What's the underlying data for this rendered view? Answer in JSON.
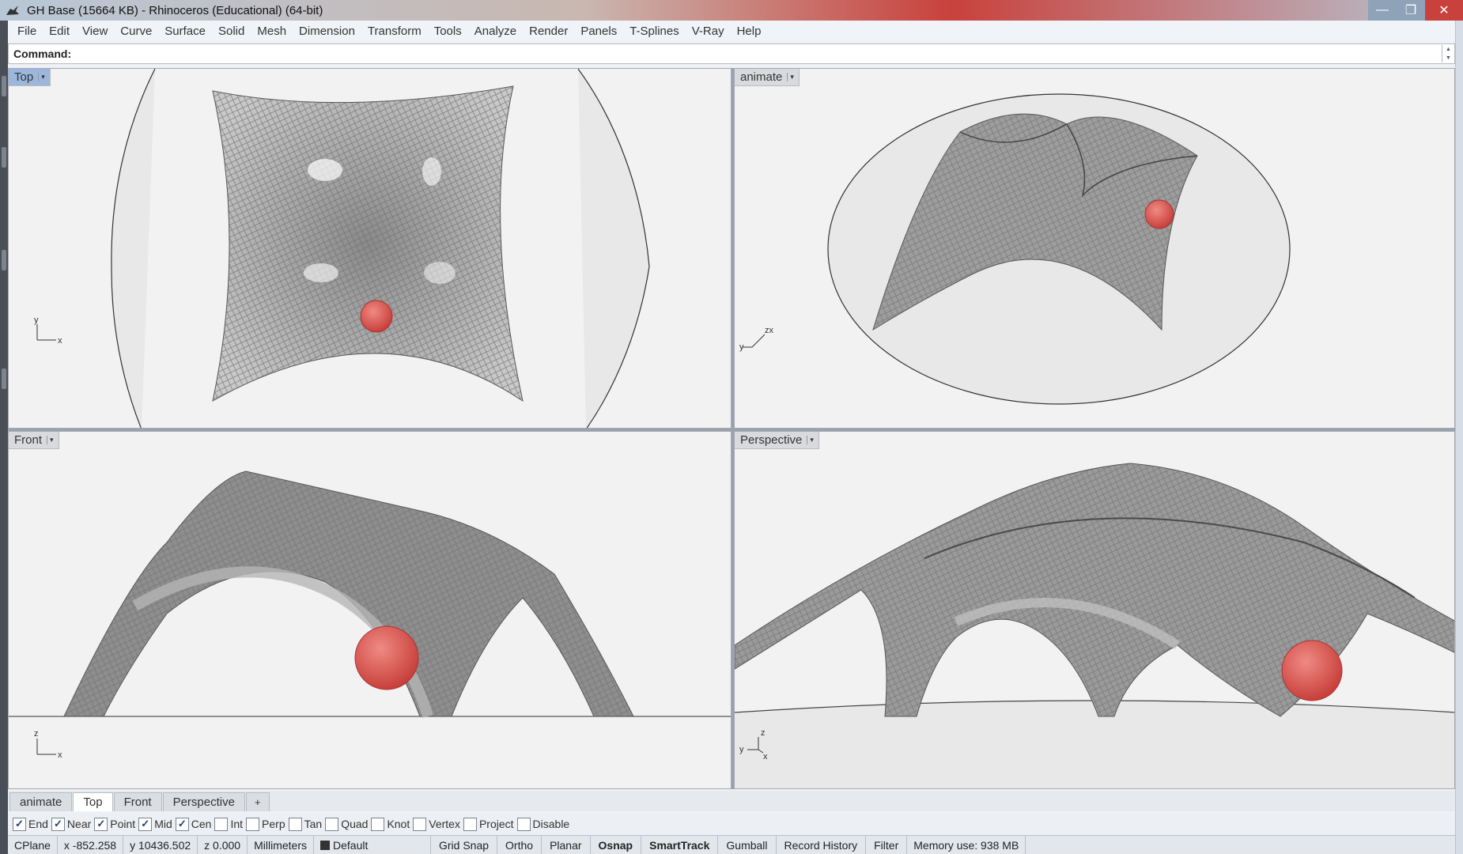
{
  "window": {
    "title": "GH Base (15664 KB) - Rhinoceros (Educational) (64-bit)",
    "min_icon": "minimize-icon",
    "max_icon": "maximize-icon",
    "close_icon": "close-icon",
    "min_glyph": "—",
    "max_glyph": "❐",
    "close_glyph": "✕"
  },
  "menu": [
    "File",
    "Edit",
    "View",
    "Curve",
    "Surface",
    "Solid",
    "Mesh",
    "Dimension",
    "Transform",
    "Tools",
    "Analyze",
    "Render",
    "Panels",
    "T-Splines",
    "V-Ray",
    "Help"
  ],
  "command": {
    "label": "Command:",
    "value": ""
  },
  "viewports": {
    "top": {
      "label": "Top",
      "axis": [
        "y",
        "x"
      ]
    },
    "animate": {
      "label": "animate",
      "axis": [
        "zx",
        "y"
      ]
    },
    "front": {
      "label": "Front",
      "axis": [
        "z",
        "x"
      ]
    },
    "perspective": {
      "label": "Perspective",
      "axis": [
        "z",
        "y",
        "x"
      ]
    },
    "dropdown_glyph": "▾"
  },
  "tabs": {
    "items": [
      "animate",
      "Top",
      "Front",
      "Perspective"
    ],
    "active": "Top",
    "add": "+"
  },
  "osnaps": [
    {
      "label": "End",
      "checked": true
    },
    {
      "label": "Near",
      "checked": true
    },
    {
      "label": "Point",
      "checked": true
    },
    {
      "label": "Mid",
      "checked": true
    },
    {
      "label": "Cen",
      "checked": true
    },
    {
      "label": "Int",
      "checked": false
    },
    {
      "label": "Perp",
      "checked": false
    },
    {
      "label": "Tan",
      "checked": false
    },
    {
      "label": "Quad",
      "checked": false
    },
    {
      "label": "Knot",
      "checked": false
    },
    {
      "label": "Vertex",
      "checked": false
    },
    {
      "label": "Project",
      "checked": false
    },
    {
      "label": "Disable",
      "checked": false
    }
  ],
  "status": {
    "cplane": "CPlane",
    "x": "x -852.258",
    "y": "y 10436.502",
    "z": "z 0.000",
    "units": "Millimeters",
    "layer": "Default",
    "toggles": [
      "Grid Snap",
      "Ortho",
      "Planar",
      "Osnap",
      "SmartTrack",
      "Gumball",
      "Record History",
      "Filter"
    ],
    "bold_toggles": [
      "Osnap",
      "SmartTrack"
    ],
    "memory": "Memory use: 938 MB"
  },
  "colors": {
    "sphere": "#d9534f",
    "mesh": "#7a7a7a",
    "viewport_bg": "#f2f2f2",
    "active_tab": "#9bb8dc"
  }
}
